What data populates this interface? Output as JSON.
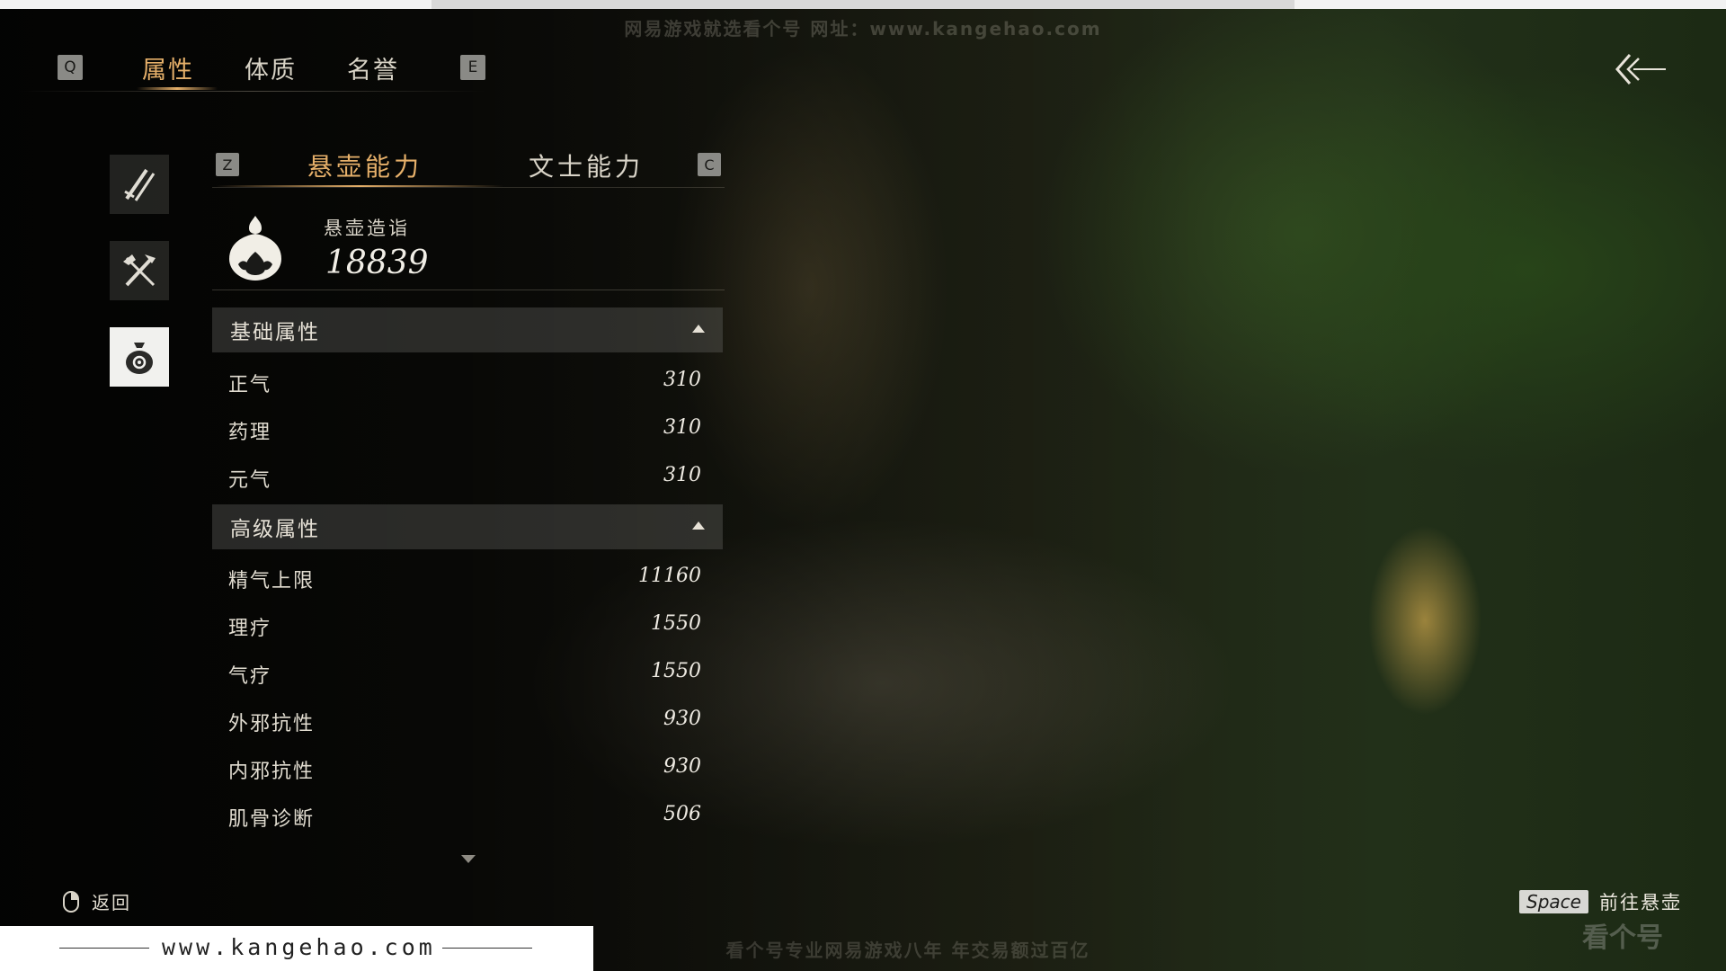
{
  "watermark": {
    "top": "网易游戏就选看个号  网址：www.kangehao.com",
    "bottom": "看个号专业网易游戏八年  年交易额过百亿",
    "site": "www.kangehao.com",
    "corner": "看个号"
  },
  "top_tabs": {
    "prev_key": "Q",
    "next_key": "E",
    "items": [
      {
        "label": "属性",
        "active": true
      },
      {
        "label": "体质",
        "active": false
      },
      {
        "label": "名誉",
        "active": false
      }
    ]
  },
  "side_icons": [
    {
      "name": "weapons-icon",
      "active": false
    },
    {
      "name": "tools-icon",
      "active": false
    },
    {
      "name": "pouch-icon",
      "active": true
    }
  ],
  "sub_tabs": {
    "prev_key": "Z",
    "next_key": "C",
    "items": [
      {
        "label": "悬壶能力",
        "active": true
      },
      {
        "label": "文士能力",
        "active": false
      }
    ]
  },
  "summary": {
    "label": "悬壶造诣",
    "value": "18839"
  },
  "sections": [
    {
      "title": "基础属性",
      "expanded": true,
      "stats": [
        {
          "name": "正气",
          "value": "310"
        },
        {
          "name": "药理",
          "value": "310"
        },
        {
          "name": "元气",
          "value": "310"
        }
      ]
    },
    {
      "title": "高级属性",
      "expanded": true,
      "stats": [
        {
          "name": "精气上限",
          "value": "11160"
        },
        {
          "name": "理疗",
          "value": "1550"
        },
        {
          "name": "气疗",
          "value": "1550"
        },
        {
          "name": "外邪抗性",
          "value": "930"
        },
        {
          "name": "内邪抗性",
          "value": "930"
        },
        {
          "name": "肌骨诊断",
          "value": "506"
        }
      ]
    }
  ],
  "footer": {
    "return_label": "返回",
    "space_key": "Space",
    "space_label": "前往悬壶"
  },
  "colors": {
    "accent": "#e6b06a",
    "text": "#d9d4c8"
  }
}
